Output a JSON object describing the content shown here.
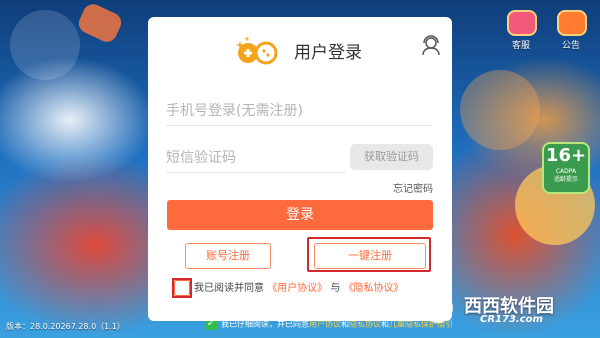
{
  "dialog": {
    "title": "用户登录",
    "phone_placeholder": "手机号登录(无需注册)",
    "code_placeholder": "短信验证码",
    "get_code_label": "获取验证码",
    "forgot_label": "忘记密码",
    "login_label": "登录",
    "account_register_label": "账号注册",
    "onekey_register_label": "一键注册",
    "agree_prefix": "我已阅读并同意",
    "user_agreement": "《用户协议》",
    "and": "与",
    "privacy_policy": "《隐私协议》"
  },
  "top_icons": {
    "service_label": "客服",
    "notice_label": "公告"
  },
  "age_badge": {
    "rating": "16+",
    "cadpa": "CADPA",
    "text": "适龄提示"
  },
  "footer": {
    "version": "版本：28.0.20267.28.0（1.1）",
    "notice_prefix": "我已仔细阅读，并已同意",
    "notice_link1": "用户协议",
    "notice_and": "和",
    "notice_link2": "隐私协议",
    "notice_and2": "和",
    "notice_link3": "儿童隐私保护指引"
  },
  "watermark": {
    "brand_logo_text": "西西",
    "site_name": "软件园",
    "url": "CR173.com"
  },
  "colors": {
    "accent": "#ff6a3d",
    "highlight_outline": "#d32b2b"
  }
}
